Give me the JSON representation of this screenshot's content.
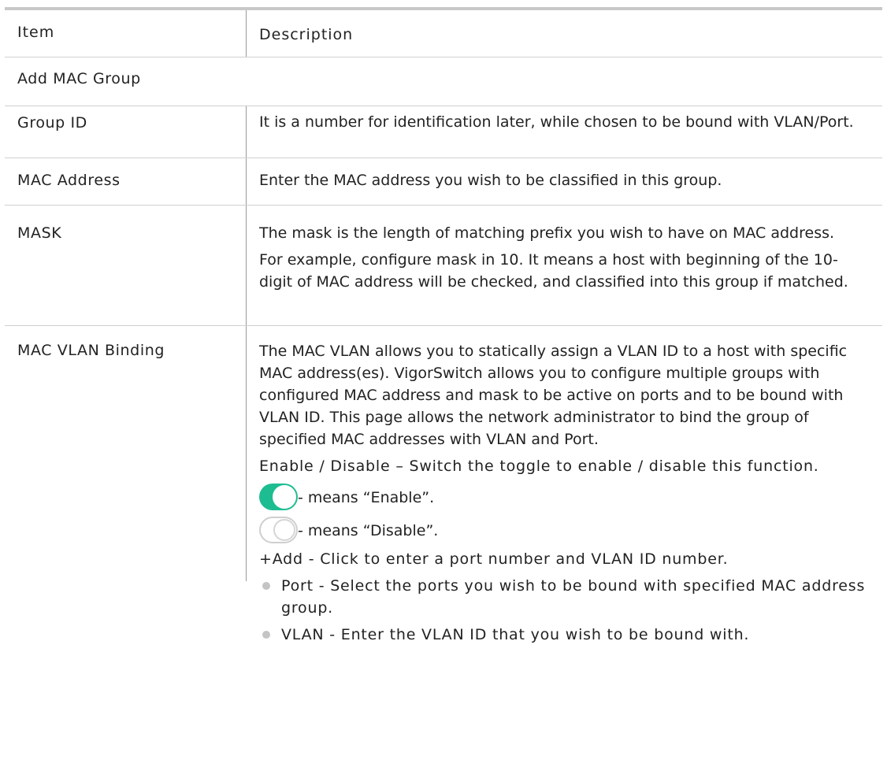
{
  "header": {
    "item": "Item",
    "description": "Description"
  },
  "section": {
    "title": "Add MAC Group"
  },
  "rows": {
    "group_id": {
      "item": "Group ID",
      "desc": "It is a number for identification later, while chosen to be bound with VLAN/Port."
    },
    "mac_address": {
      "item": "MAC Address",
      "desc": "Enter the MAC address you wish to be classified in this group."
    },
    "mask": {
      "item": "MASK",
      "desc1": "The mask is the length of matching prefix you wish to have on MAC address.",
      "desc2": "For example, configure mask in 10. It means a host with beginning of the 10-digit of MAC address will be checked, and classified into this group if matched."
    },
    "binding": {
      "item": "MAC VLAN Binding",
      "desc1": "The MAC VLAN allows you to statically assign a VLAN ID to a host with specific MAC address(es). VigorSwitch allows you to configure multiple groups with configured MAC address and mask to be active on ports and to be bound with VLAN ID. This page allows the network administrator to bind the group of specified MAC addresses with VLAN and Port.",
      "toggle_desc": "Enable / Disable – Switch the toggle to enable / disable this function.",
      "toggle_on_label": "- means “Enable”.",
      "toggle_off_label": "- means “Disable”.",
      "add_desc": "+Add - Click to enter a port number and VLAN ID number.",
      "bullets": [
        "Port - Select the ports you wish to be bound with specified MAC address group.",
        "VLAN - Enter the VLAN ID that you wish to be bound with."
      ]
    }
  },
  "colors": {
    "toggle_on": "#1ebd91",
    "toggle_off_border": "#cfcfcf",
    "rule": "#c8c8c8"
  },
  "icons": {
    "toggle_on": "toggle-on-icon",
    "toggle_off": "toggle-off-icon",
    "bullet": "bullet-dot-icon"
  }
}
